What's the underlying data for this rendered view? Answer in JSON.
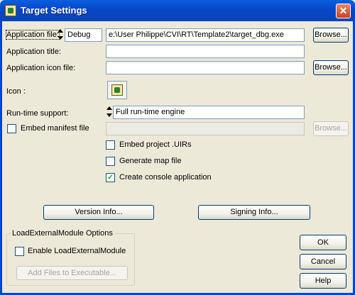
{
  "window": {
    "title": "Target Settings",
    "close_glyph": "✕"
  },
  "fields": {
    "application_file": {
      "label": "Application file:",
      "config": "Debug",
      "value": "e:\\User Philippe\\CVI\\RT\\Template2\\target_dbg.exe",
      "browse": "Browse..."
    },
    "application_title": {
      "label": "Application title:",
      "value": ""
    },
    "application_icon_file": {
      "label": "Application icon file:",
      "value": "",
      "browse": "Browse..."
    },
    "icon": {
      "label": "Icon :",
      "icon_name": "cvi-application-icon"
    },
    "runtime_support": {
      "label": "Run-time support:",
      "value": "Full run-time engine"
    },
    "manifest": {
      "label": "Embed manifest file",
      "checked": false,
      "value": "",
      "browse": "Browse..."
    }
  },
  "options": {
    "embed_uirs": {
      "label": "Embed project .UIRs",
      "checked": false
    },
    "generate_map": {
      "label": "Generate map file",
      "checked": false
    },
    "console_app": {
      "label": "Create console application",
      "checked": true
    }
  },
  "buttons": {
    "version_info": "Version Info...",
    "signing_info": "Signing Info...",
    "ok": "OK",
    "cancel": "Cancel",
    "help": "Help"
  },
  "load_external": {
    "group_title": "LoadExternalModule Options",
    "enable_label": "Enable LoadExternalModule",
    "enable_checked": false,
    "add_files": "Add Files to Executable..."
  },
  "colors": {
    "title_bar": "#0747c8",
    "dialog_bg": "#ece9d8",
    "check_mark": "#21a121"
  }
}
